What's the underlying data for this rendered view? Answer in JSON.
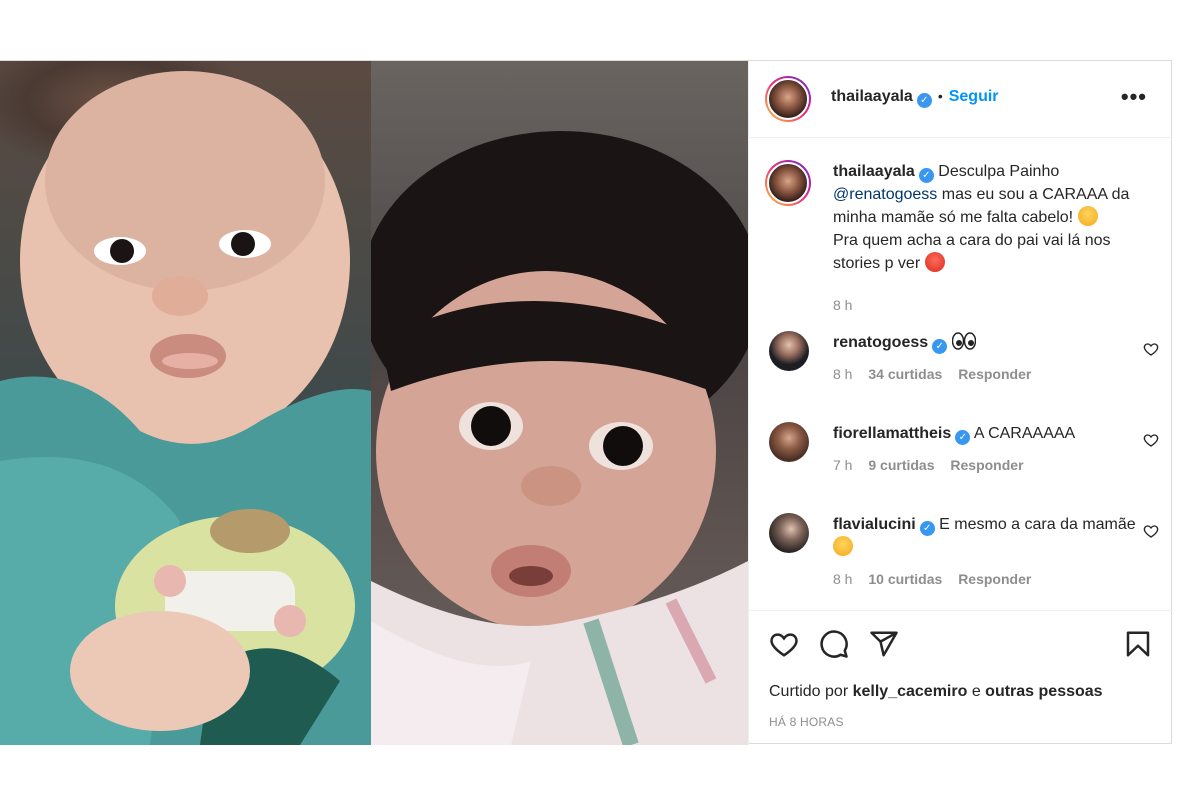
{
  "post": {
    "author": "thailaayala",
    "follow_label": "Seguir",
    "separator": "•",
    "more_label": "•••"
  },
  "caption": {
    "username": "thailaayala",
    "text_before_mention": "Desculpa Painho",
    "mention": "@renatogoess",
    "text_after_mention": "mas eu sou a CARAAA da minha mamãe só me falta cabelo!",
    "text_line2": "Pra quem acha a cara do pai vai lá nos stories p ver",
    "time": "8 h"
  },
  "comments": [
    {
      "username": "renatogoess",
      "text": "",
      "emoji": "eyes-emoji",
      "time": "8 h",
      "likes": "34 curtidas",
      "reply": "Responder"
    },
    {
      "username": "fiorellamattheis",
      "text": "A CARAAAAA",
      "time": "7 h",
      "likes": "9 curtidas",
      "reply": "Responder"
    },
    {
      "username": "flavialucini",
      "text": "E mesmo a cara da mamãe",
      "emoji": "heart-eyes-emoji",
      "time": "8 h",
      "likes": "10 curtidas",
      "reply": "Responder"
    }
  ],
  "footer": {
    "liked_by_prefix": "Curtido por",
    "liked_by_user": "kelly_cacemiro",
    "liked_by_joiner": "e",
    "liked_by_others": "outras pessoas",
    "timestamp": "HÁ 8 HORAS"
  },
  "icons": {
    "like": "heart-icon",
    "comment": "comment-icon",
    "share": "paper-plane-icon",
    "save": "bookmark-icon",
    "verified": "verified-badge-icon"
  },
  "colors": {
    "accent": "#0095f6",
    "verified": "#3897f0",
    "mention": "#00376b",
    "muted": "#8e8e8e"
  }
}
